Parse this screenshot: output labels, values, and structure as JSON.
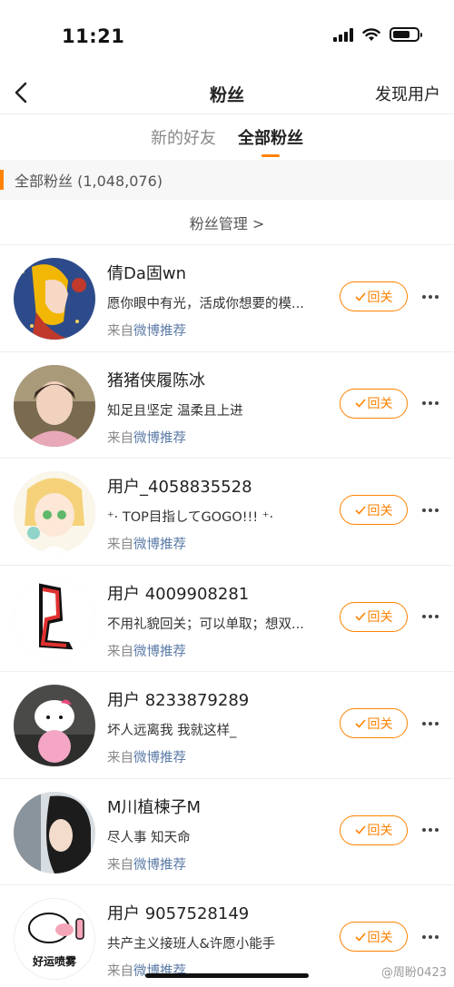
{
  "status_bar": {
    "time": "11:21"
  },
  "nav": {
    "title": "粉丝",
    "action": "发现用户"
  },
  "tabs": [
    {
      "label": "新的好友",
      "active": false
    },
    {
      "label": "全部粉丝",
      "active": true
    }
  ],
  "section": {
    "label": "全部粉丝 (1,048,076)"
  },
  "manage": {
    "label": "粉丝管理 >"
  },
  "fans": [
    {
      "name": "倩Da固wn",
      "bio": "愿你眼中有光，活成你想要的模...",
      "source_prefix": "来自",
      "source_link": "微博推荐",
      "button": "回关"
    },
    {
      "name": "猪猪侠履陈冰",
      "bio": "知足且坚定 温柔且上进",
      "source_prefix": "来自",
      "source_link": "微博推荐",
      "button": "回关"
    },
    {
      "name": "用户_4058835528",
      "bio": "⁺· TOP目指してGOGO!!! ⁺·",
      "source_prefix": "来自",
      "source_link": "微博推荐",
      "button": "回关"
    },
    {
      "name": "用户 4009908281",
      "bio": "不用礼貌回关；可以单取；想双...",
      "source_prefix": "来自",
      "source_link": "微博推荐",
      "button": "回关"
    },
    {
      "name": "用户 8233879289",
      "bio": "坏人远离我 我就这样_",
      "source_prefix": "来自",
      "source_link": "微博推荐",
      "button": "回关"
    },
    {
      "name": "M川植楝子M",
      "bio": "尽人事 知天命",
      "source_prefix": "来自",
      "source_link": "微博推荐",
      "button": "回关"
    },
    {
      "name": "用户 9057528149",
      "bio": "共产主义接班人&许愿小能手",
      "source_prefix": "来自",
      "source_link": "微博推荐",
      "button": "回关",
      "avatar_text": "好运喷雾"
    }
  ],
  "watermark": "@周盼0423",
  "colors": {
    "accent": "#ff8200",
    "link": "#5b7ba6"
  }
}
